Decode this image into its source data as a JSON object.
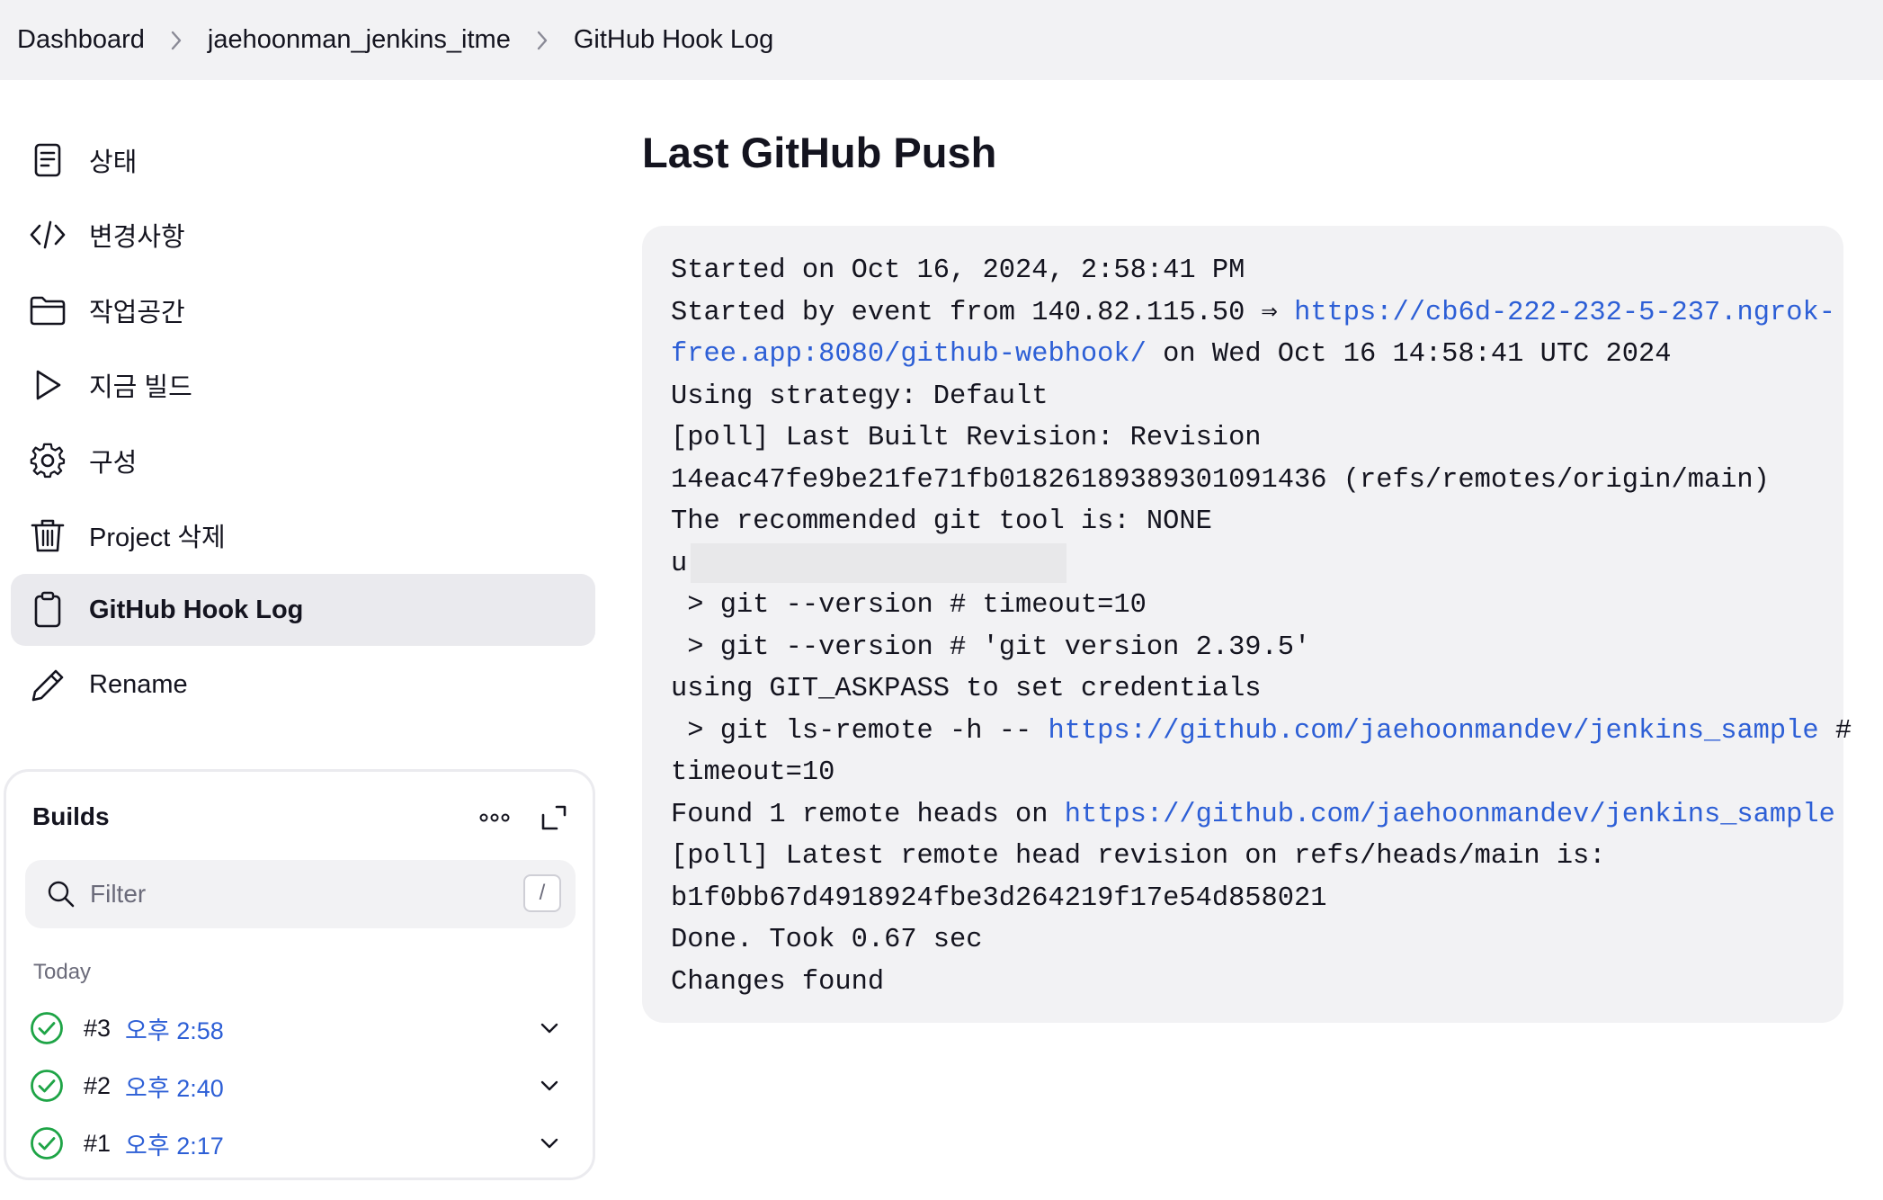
{
  "breadcrumb": {
    "items": [
      "Dashboard",
      "jaehoonman_jenkins_itme",
      "GitHub Hook Log"
    ]
  },
  "sidebar": {
    "items": [
      {
        "label": "상태",
        "icon": "document-icon"
      },
      {
        "label": "변경사항",
        "icon": "code-icon"
      },
      {
        "label": "작업공간",
        "icon": "folder-icon"
      },
      {
        "label": "지금 빌드",
        "icon": "play-icon"
      },
      {
        "label": "구성",
        "icon": "gear-icon"
      },
      {
        "label": "Project 삭제",
        "icon": "trash-icon"
      },
      {
        "label": "GitHub Hook Log",
        "icon": "clipboard-icon",
        "active": true
      },
      {
        "label": "Rename",
        "icon": "pencil-icon"
      }
    ]
  },
  "builds": {
    "title": "Builds",
    "filter_placeholder": "Filter",
    "filter_shortcut": "/",
    "group_label": "Today",
    "items": [
      {
        "number": "#3",
        "time": "오후 2:58",
        "status": "success"
      },
      {
        "number": "#2",
        "time": "오후 2:40",
        "status": "success"
      },
      {
        "number": "#1",
        "time": "오후 2:17",
        "status": "success"
      }
    ]
  },
  "main": {
    "title": "Last GitHub Push",
    "log": {
      "line1": "Started on Oct 16, 2024, 2:58:41 PM",
      "line2_prefix": "Started by event from 140.82.115.50 ⇒ ",
      "line2_link": "https://cb6d-222-232-5-237.ngrok-",
      "line3_link": "free.app:8080/github-webhook/",
      "line3_suffix": " on Wed Oct 16 14:58:41 UTC 2024",
      "line4": "Using strategy: Default",
      "line5": "[poll] Last Built Revision: Revision",
      "line6": "14eac47fe9be21fe71fb0182618938930109143​6 (refs/remotes/origin/main)",
      "line7": "The recommended git tool is: NONE",
      "line8_visible": "u",
      "line9": " > git --version # timeout=10",
      "line10": " > git --version # 'git version 2.39.5'",
      "line11": "using GIT_ASKPASS to set credentials",
      "line12_prefix": " > git ls-remote -h -- ",
      "line12_link": "https://github.com/jaehoonmandev/jenkins_sample",
      "line12_suffix": " #",
      "line13": "timeout=10",
      "line14_prefix": "Found 1 remote heads on ",
      "line14_link": "https://github.com/jaehoonmandev/jenkins_sample",
      "line15": "[poll] Latest remote head revision on refs/heads/main is:",
      "line16": "b1f0bb67d4918924fbe3d264219f17e54d858021",
      "line17": "Done. Took 0.67 sec",
      "line18": "Changes found"
    }
  },
  "colors": {
    "link": "#2d5fd6",
    "success": "#1ea446",
    "panel_bg": "#f2f2f4",
    "topbar_bg": "#f2f2f4",
    "active_item_bg": "#eaeaee"
  }
}
